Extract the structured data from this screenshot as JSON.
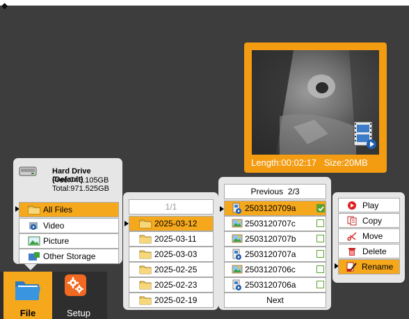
{
  "top_mark": "◆",
  "preview": {
    "length": "Length:00:02:17",
    "size": "Size:20MB"
  },
  "drive": {
    "title": "Hard Drive (Default)",
    "free": "Free:746.105GB",
    "total": "Total:971.525GB",
    "items": [
      {
        "label": "All Files",
        "icon": "folder-icon",
        "selected": true
      },
      {
        "label": "Video",
        "icon": "video-icon",
        "selected": false
      },
      {
        "label": "Picture",
        "icon": "picture-icon",
        "selected": false
      },
      {
        "label": "Other Storage",
        "icon": "storage-icon",
        "selected": false
      }
    ]
  },
  "dates": {
    "page": "1/1",
    "items": [
      "2025-03-12",
      "2025-03-11",
      "2025-03-03",
      "2025-02-25",
      "2025-02-23",
      "2025-02-19"
    ],
    "selected_index": 0
  },
  "files": {
    "previous": "Previous",
    "page": "2/3",
    "next": "Next",
    "items": [
      {
        "name": "2503120709a",
        "type": "video",
        "checked": true
      },
      {
        "name": "2503120707c",
        "type": "picture",
        "checked": false
      },
      {
        "name": "2503120707b",
        "type": "picture",
        "checked": false
      },
      {
        "name": "2503120707a",
        "type": "video",
        "checked": false
      },
      {
        "name": "2503120706c",
        "type": "picture",
        "checked": false
      },
      {
        "name": "2503120706a",
        "type": "video",
        "checked": false
      }
    ],
    "selected_index": 0
  },
  "actions": {
    "play": "Play",
    "copy": "Copy",
    "move": "Move",
    "delete": "Delete",
    "rename": "Rename",
    "selected": "rename"
  },
  "taskbar": {
    "file": "File",
    "setup": "Setup"
  },
  "colors": {
    "accent": "#f5a81c",
    "preview_frame": "#f39c12",
    "background": "#3d3d3d",
    "panel": "#e6e6e6"
  }
}
